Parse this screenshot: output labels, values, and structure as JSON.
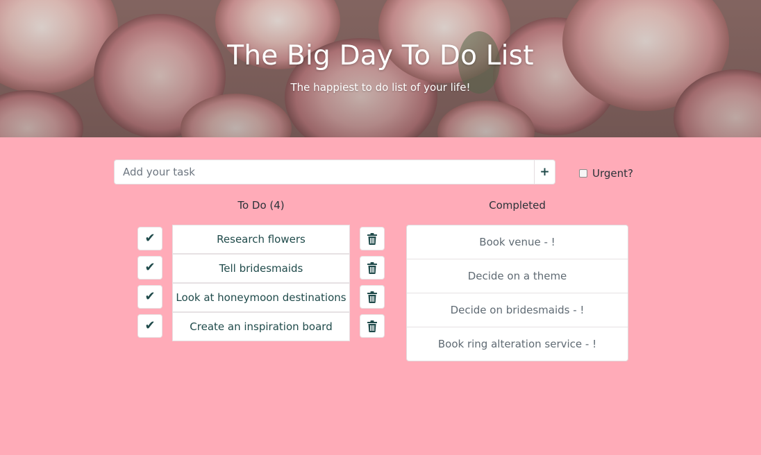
{
  "header": {
    "title": "The Big Day To Do List",
    "subtitle": "The happiest to do list of your life!"
  },
  "add_task": {
    "placeholder": "Add your task",
    "add_label": "+",
    "urgent_label": "Urgent?",
    "urgent_checked": false
  },
  "todo": {
    "heading": "To Do (4)",
    "check_glyph": "✔",
    "items": [
      {
        "label": "Research flowers"
      },
      {
        "label": "Tell bridesmaids"
      },
      {
        "label": "Look at honeymoon destinations"
      },
      {
        "label": "Create an inspiration board"
      }
    ]
  },
  "completed": {
    "heading": "Completed",
    "items": [
      {
        "label": "Book venue - !"
      },
      {
        "label": "Decide on a theme"
      },
      {
        "label": "Decide on bridesmaids - !"
      },
      {
        "label": "Book ring alteration service - !"
      }
    ]
  },
  "icons": {
    "check": "check-icon",
    "trash": "trash-icon",
    "add": "plus-icon"
  },
  "colors": {
    "page_background": "#ffabb8",
    "accent": "#1f4a4a",
    "card": "#ffffff",
    "completed_text": "#5f6a73"
  }
}
